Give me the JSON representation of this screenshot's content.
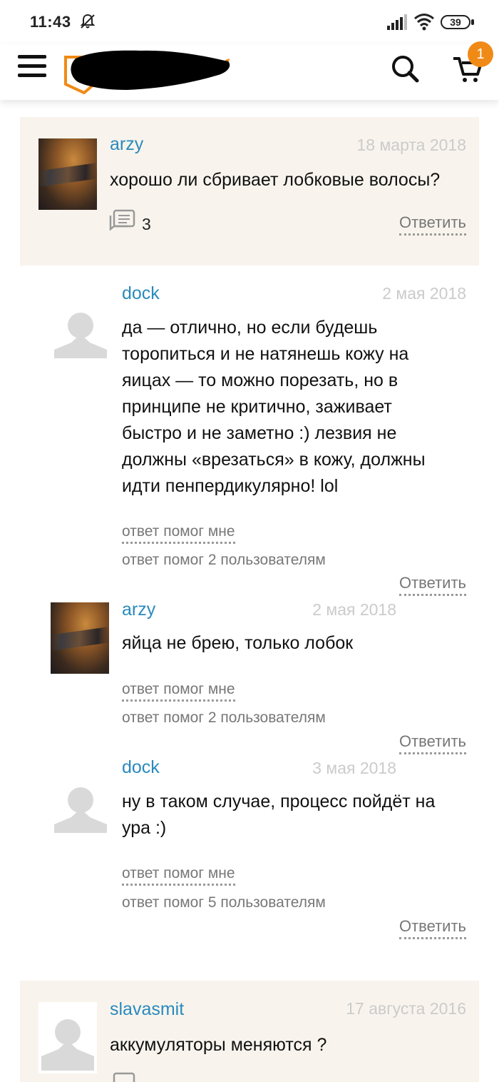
{
  "status_bar": {
    "time": "11:43",
    "battery": "39"
  },
  "header": {
    "cart_count": "1"
  },
  "comments": [
    {
      "author": "arzy",
      "date": "18 марта 2018",
      "text": "хорошо ли сбривает лобковые волосы?",
      "replies_count": "3",
      "reply_label": "Ответить"
    },
    {
      "author": "dock",
      "date": "2 мая 2018",
      "lines": [
        "да — отлично, но если будешь",
        "торопиться и не натянешь кожу на",
        "яицах — то можно порезать, но в",
        "принципе не критично, заживает",
        "быстро и не заметно :) лезвия не",
        "должны «врезаться» в кожу, должны",
        "идти пенпердикулярно! lol"
      ],
      "helped_label": "ответ помог мне",
      "helped_count": "ответ помог 2 пользователям",
      "reply_label": "Ответить"
    },
    {
      "author": "arzy",
      "date": "2 мая 2018",
      "text": "яйца не брею, только лобок",
      "helped_label": "ответ помог мне",
      "helped_count": "ответ помог 2 пользователям",
      "reply_label": "Ответить"
    },
    {
      "author": "dock",
      "date": "3 мая 2018",
      "lines": [
        "ну в таком случае, процесс пойдёт на",
        "ура :)"
      ],
      "helped_label": "ответ помог мне",
      "helped_count": "ответ помог 5 пользователям",
      "reply_label": "Ответить"
    },
    {
      "author": "slavasmit",
      "date": "17 августа 2016",
      "text": "аккумуляторы меняются ?"
    }
  ]
}
